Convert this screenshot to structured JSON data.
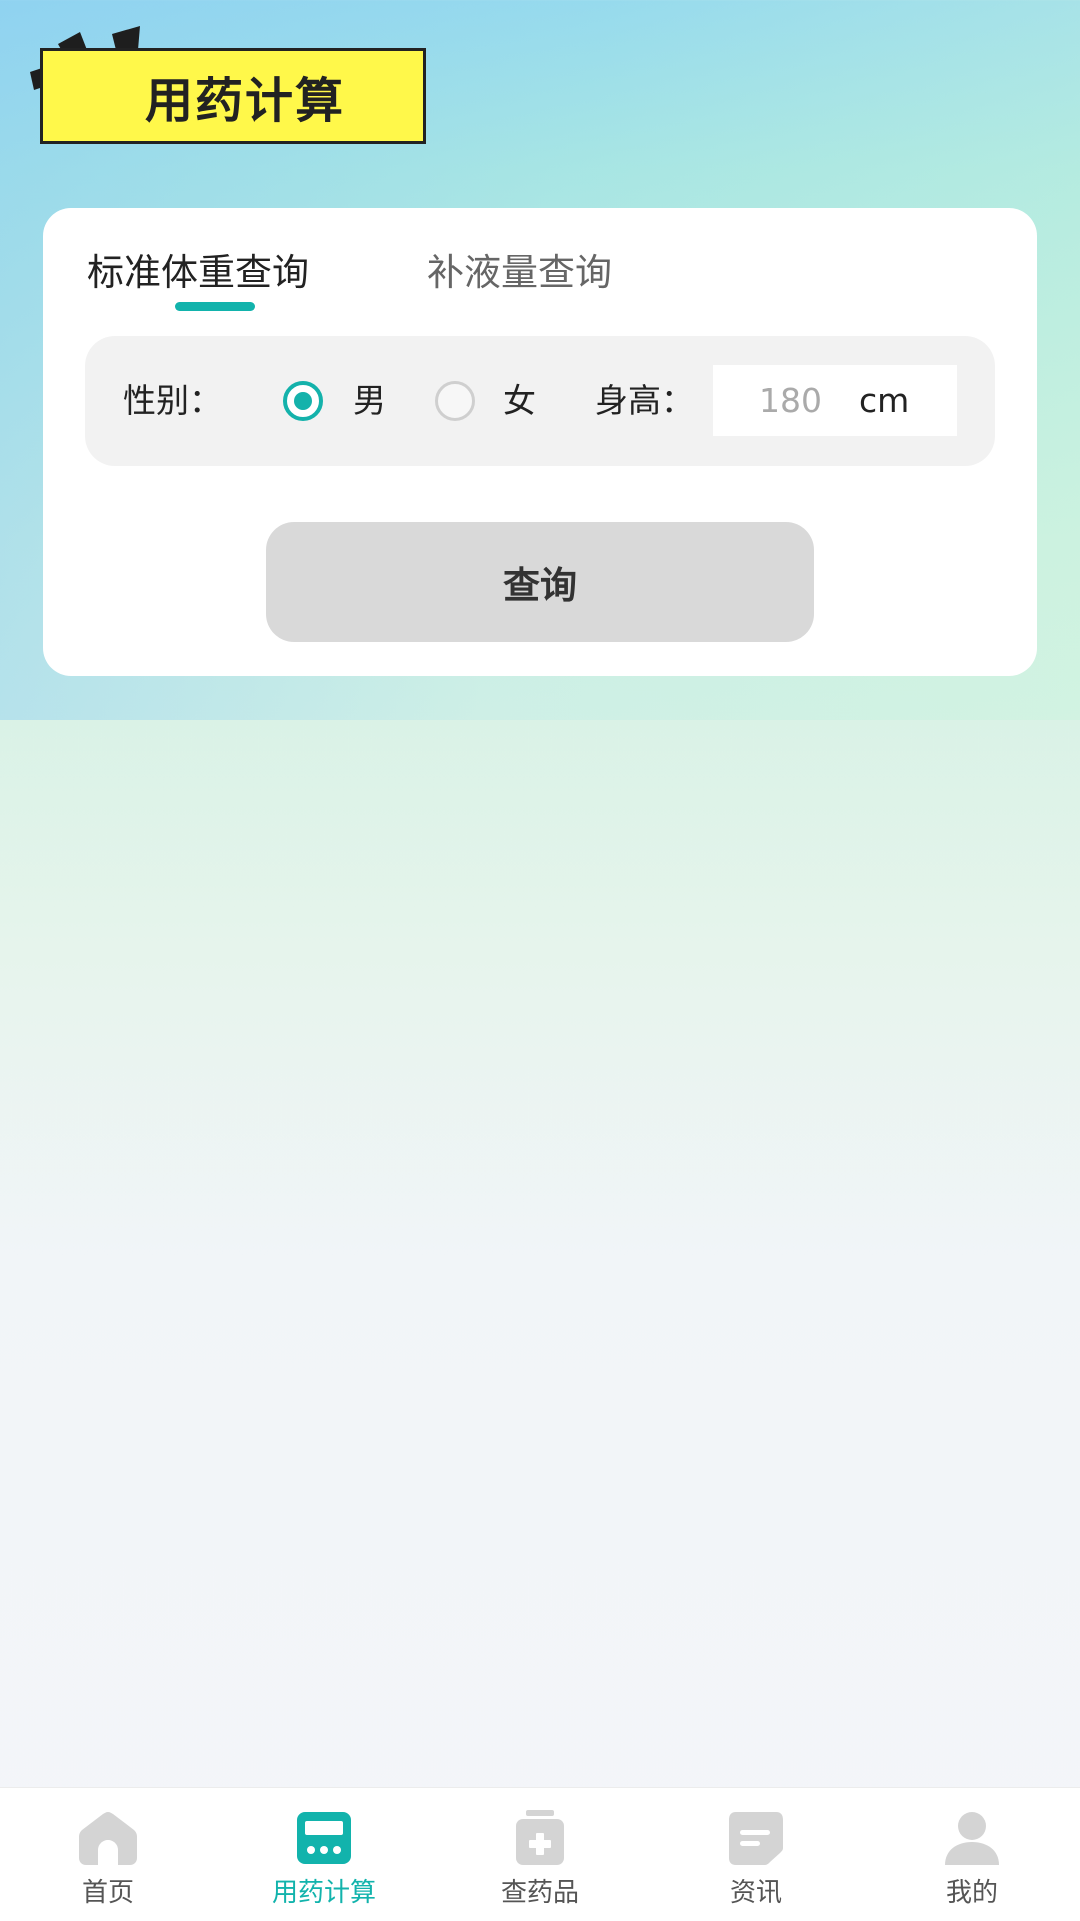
{
  "header": {
    "title": "用药计算"
  },
  "tabs": [
    {
      "label": "标准体重查询",
      "active": true
    },
    {
      "label": "补液量查询",
      "active": false
    }
  ],
  "form": {
    "gender_label": "性别：",
    "gender_options": [
      {
        "label": "男",
        "checked": true
      },
      {
        "label": "女",
        "checked": false
      }
    ],
    "height_label": "身高：",
    "height_placeholder": "180",
    "height_value": "",
    "height_unit": "cm"
  },
  "query_button": {
    "label": "查询"
  },
  "bottom_nav": [
    {
      "label": "首页",
      "icon": "home-icon",
      "active": false
    },
    {
      "label": "用药计算",
      "icon": "calculator-icon",
      "active": true
    },
    {
      "label": "查药品",
      "icon": "medicine-box-icon",
      "active": false
    },
    {
      "label": "资讯",
      "icon": "message-icon",
      "active": false
    },
    {
      "label": "我的",
      "icon": "user-icon",
      "active": false
    }
  ],
  "colors": {
    "accent": "#12b3ac",
    "title_badge": "#fff84a",
    "icon_inactive": "#d4d4d4"
  }
}
